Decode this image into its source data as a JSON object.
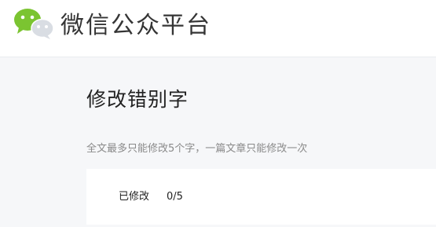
{
  "header": {
    "logo_icon": "wechat-logo-icon",
    "brand_name": "微信公众平台"
  },
  "page": {
    "title": "修改错别字",
    "hint": "全文最多只能修改5个字，一篇文章只能修改一次"
  },
  "edit_status": {
    "label": "已修改",
    "value": "0/5"
  },
  "colors": {
    "logo_green": "#7bc431",
    "logo_grey": "#d9dde3",
    "page_background": "#f6f7f9"
  }
}
